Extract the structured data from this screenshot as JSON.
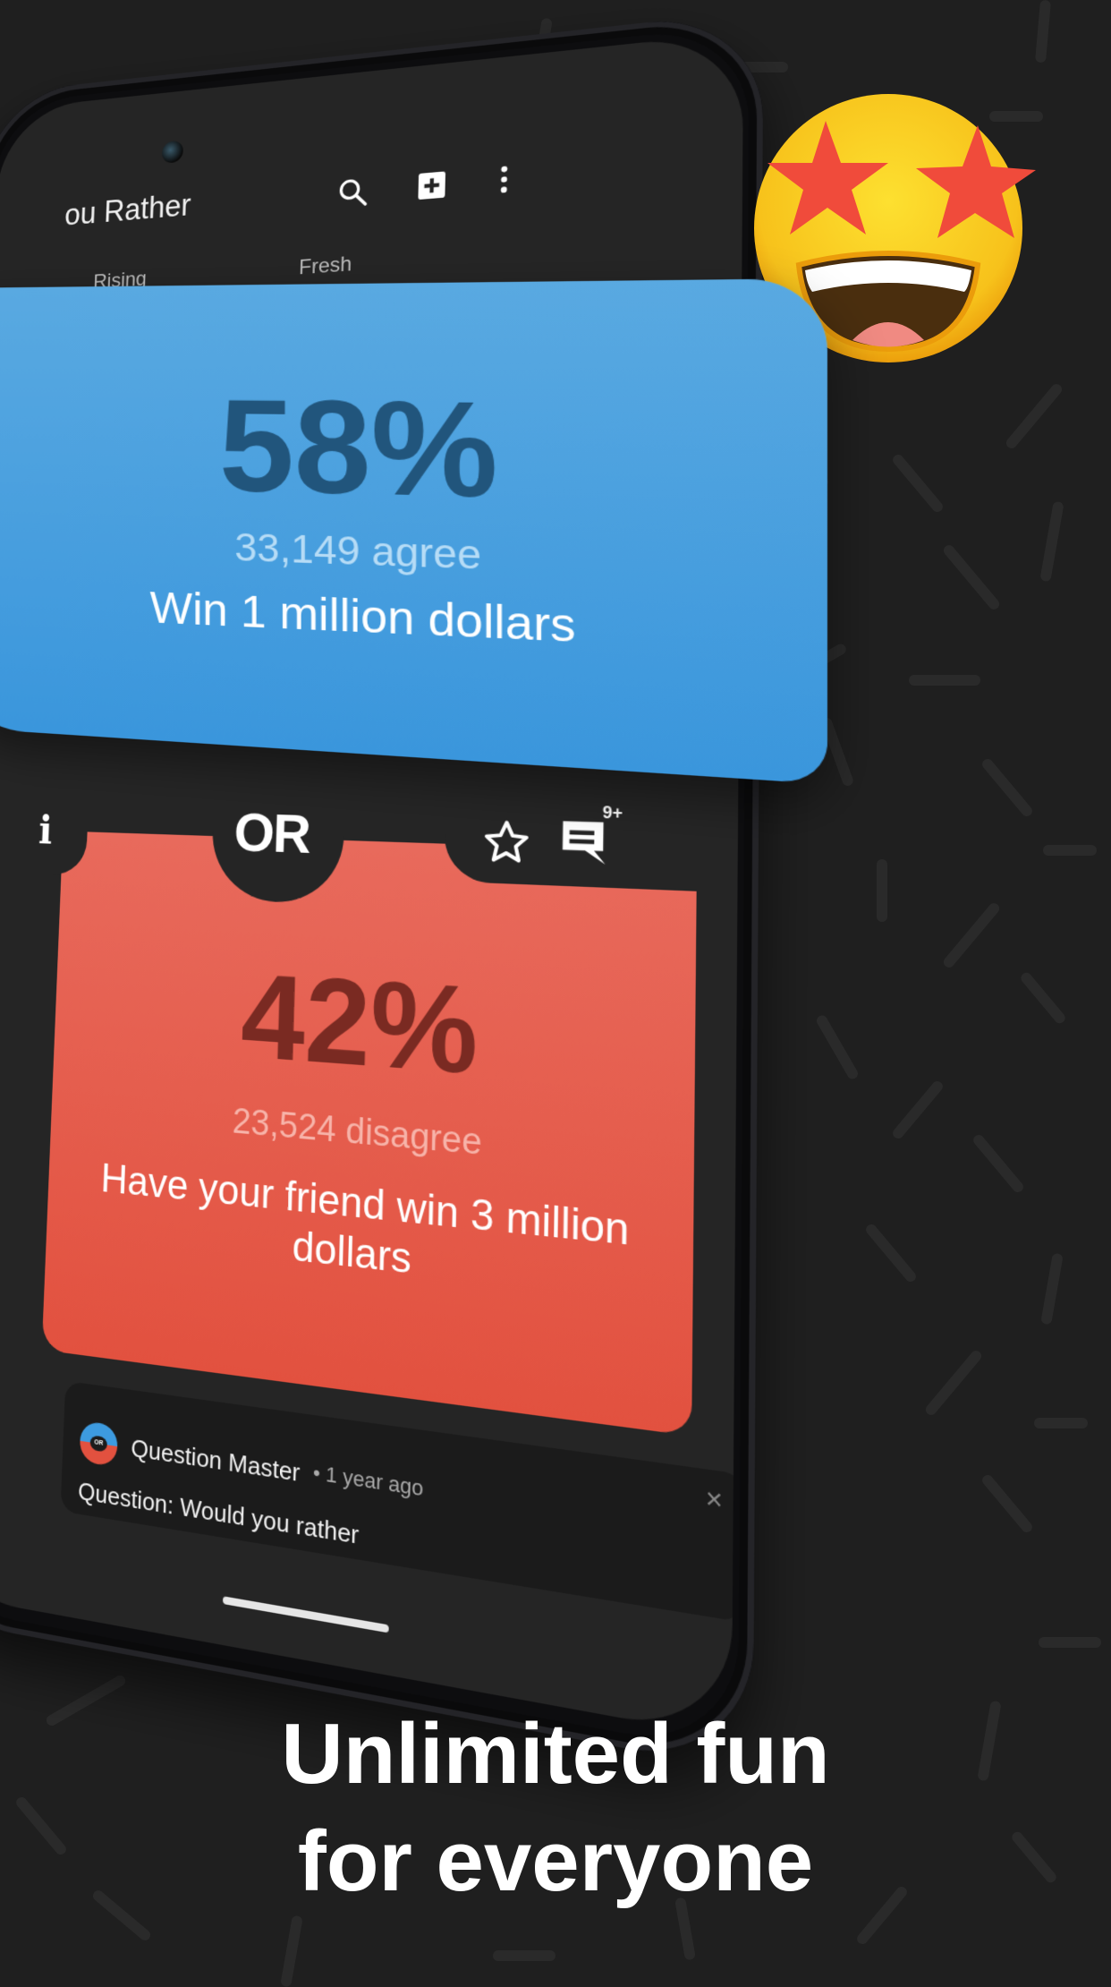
{
  "app": {
    "title": "ou Rather",
    "icons": [
      "search-icon",
      "add-question-icon",
      "more-vert-icon"
    ]
  },
  "tabs": [
    {
      "label": "Rising"
    },
    {
      "label": "Fresh"
    }
  ],
  "option_a": {
    "percent": "58%",
    "count": "33,149 agree",
    "text": "Win 1 million dollars",
    "color": "#3d9be0"
  },
  "divider": {
    "logo": "OR",
    "info_icon": "i",
    "comments_badge": "9+"
  },
  "option_b": {
    "percent": "42%",
    "count": "23,524 disagree",
    "text": "Have your friend win 3 million dollars",
    "color": "#e2513f"
  },
  "notification": {
    "author": "Question Master",
    "separator": "•",
    "time": "1 year ago",
    "question": "Question: Would you rather",
    "close": "×",
    "avatar_label": "OR"
  },
  "headline": {
    "line1": "Unlimited fun",
    "line2": "for everyone"
  }
}
